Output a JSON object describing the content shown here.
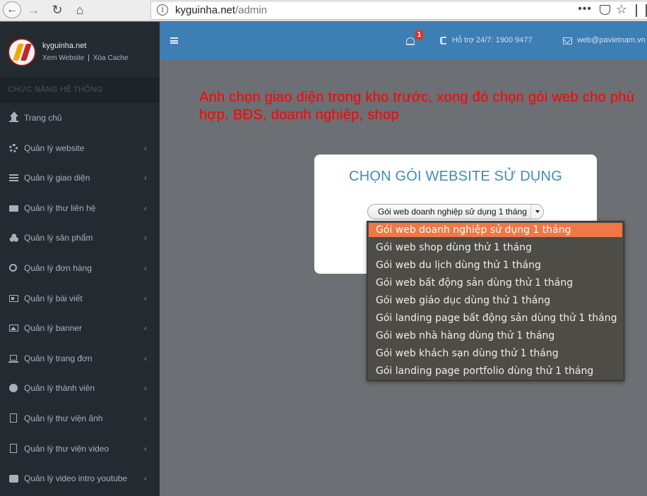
{
  "browser": {
    "url_domain": "kyguinha.net",
    "url_path": "/admin",
    "back_icon": "arrow-left-icon",
    "forward_icon": "arrow-right-icon",
    "reload_icon": "reload-icon",
    "home_icon": "home-icon",
    "info_glyph": "i",
    "menu_dots": "•••",
    "star_glyph": "☆"
  },
  "sidebar": {
    "site_name": "kyguinha.net",
    "link_view": "Xem Website",
    "link_separator": "|",
    "link_cache": "Xóa Cache",
    "section_title": "CHỨC NĂNG HỆ THỐNG",
    "chevron": "‹",
    "items": [
      {
        "label": "Trang chủ",
        "icon": "home-icon"
      },
      {
        "label": "Quản lý website",
        "icon": "gears-icon"
      },
      {
        "label": "Quản lý giao diện",
        "icon": "bars-icon"
      },
      {
        "label": "Quản lý thư liên hệ",
        "icon": "envelope-icon"
      },
      {
        "label": "Quản lý sản phẩm",
        "icon": "cubes-icon"
      },
      {
        "label": "Quản lý đơn hàng",
        "icon": "circle-icon"
      },
      {
        "label": "Quản lý bài viết",
        "icon": "newspaper-icon"
      },
      {
        "label": "Quản lý banner",
        "icon": "image-icon"
      },
      {
        "label": "Quản lý trang đơn",
        "icon": "laptop-icon"
      },
      {
        "label": "Quản lý thành viên",
        "icon": "user-circle-icon"
      },
      {
        "label": "Quản lý thư viện ảnh",
        "icon": "file-image-icon"
      },
      {
        "label": "Quản lý thư viện video",
        "icon": "file-video-icon"
      },
      {
        "label": "Quản lý video intro youtube",
        "icon": "youtube-icon"
      }
    ]
  },
  "topnav": {
    "notification_count": "1",
    "support": "Hỗ trợ 24/7: 1900 9477",
    "email": "web@pavietnam.vn"
  },
  "annotation": "Anh chọn giao diện trong kho trước, xong đó chọn gói web cho phù hợp, BĐS, doanh nghiệp, shop",
  "modal": {
    "title": "CHỌN GÓI WEBSITE SỬ DỤNG",
    "select_value": "Gói web doanh nghiệp sử dụng 1 tháng"
  },
  "dropdown": {
    "options": [
      "Gói web doanh nghiệp sử dụng 1 tháng",
      "Gói web shop dùng thử 1 tháng",
      "Gói web du lịch dùng thử 1 tháng",
      "Gói web bất động sản dùng thử 1 tháng",
      "Gói web giáo dục dùng thử 1 tháng",
      "Gói landing page bất động sản dùng thử 1 tháng",
      "Gói web nhà hàng dùng thử 1 tháng",
      "Gói web khách sạn dùng thử 1 tháng",
      "Gói landing page portfolio dùng thử 1 tháng"
    ],
    "selected_index": 0,
    "highlight_color": "#f07746"
  },
  "colors": {
    "sidebar_bg": "#232b30",
    "topnav_bg": "#3d7eb5",
    "title_blue": "#3c8dbc",
    "annotation_red": "#ff0000"
  }
}
